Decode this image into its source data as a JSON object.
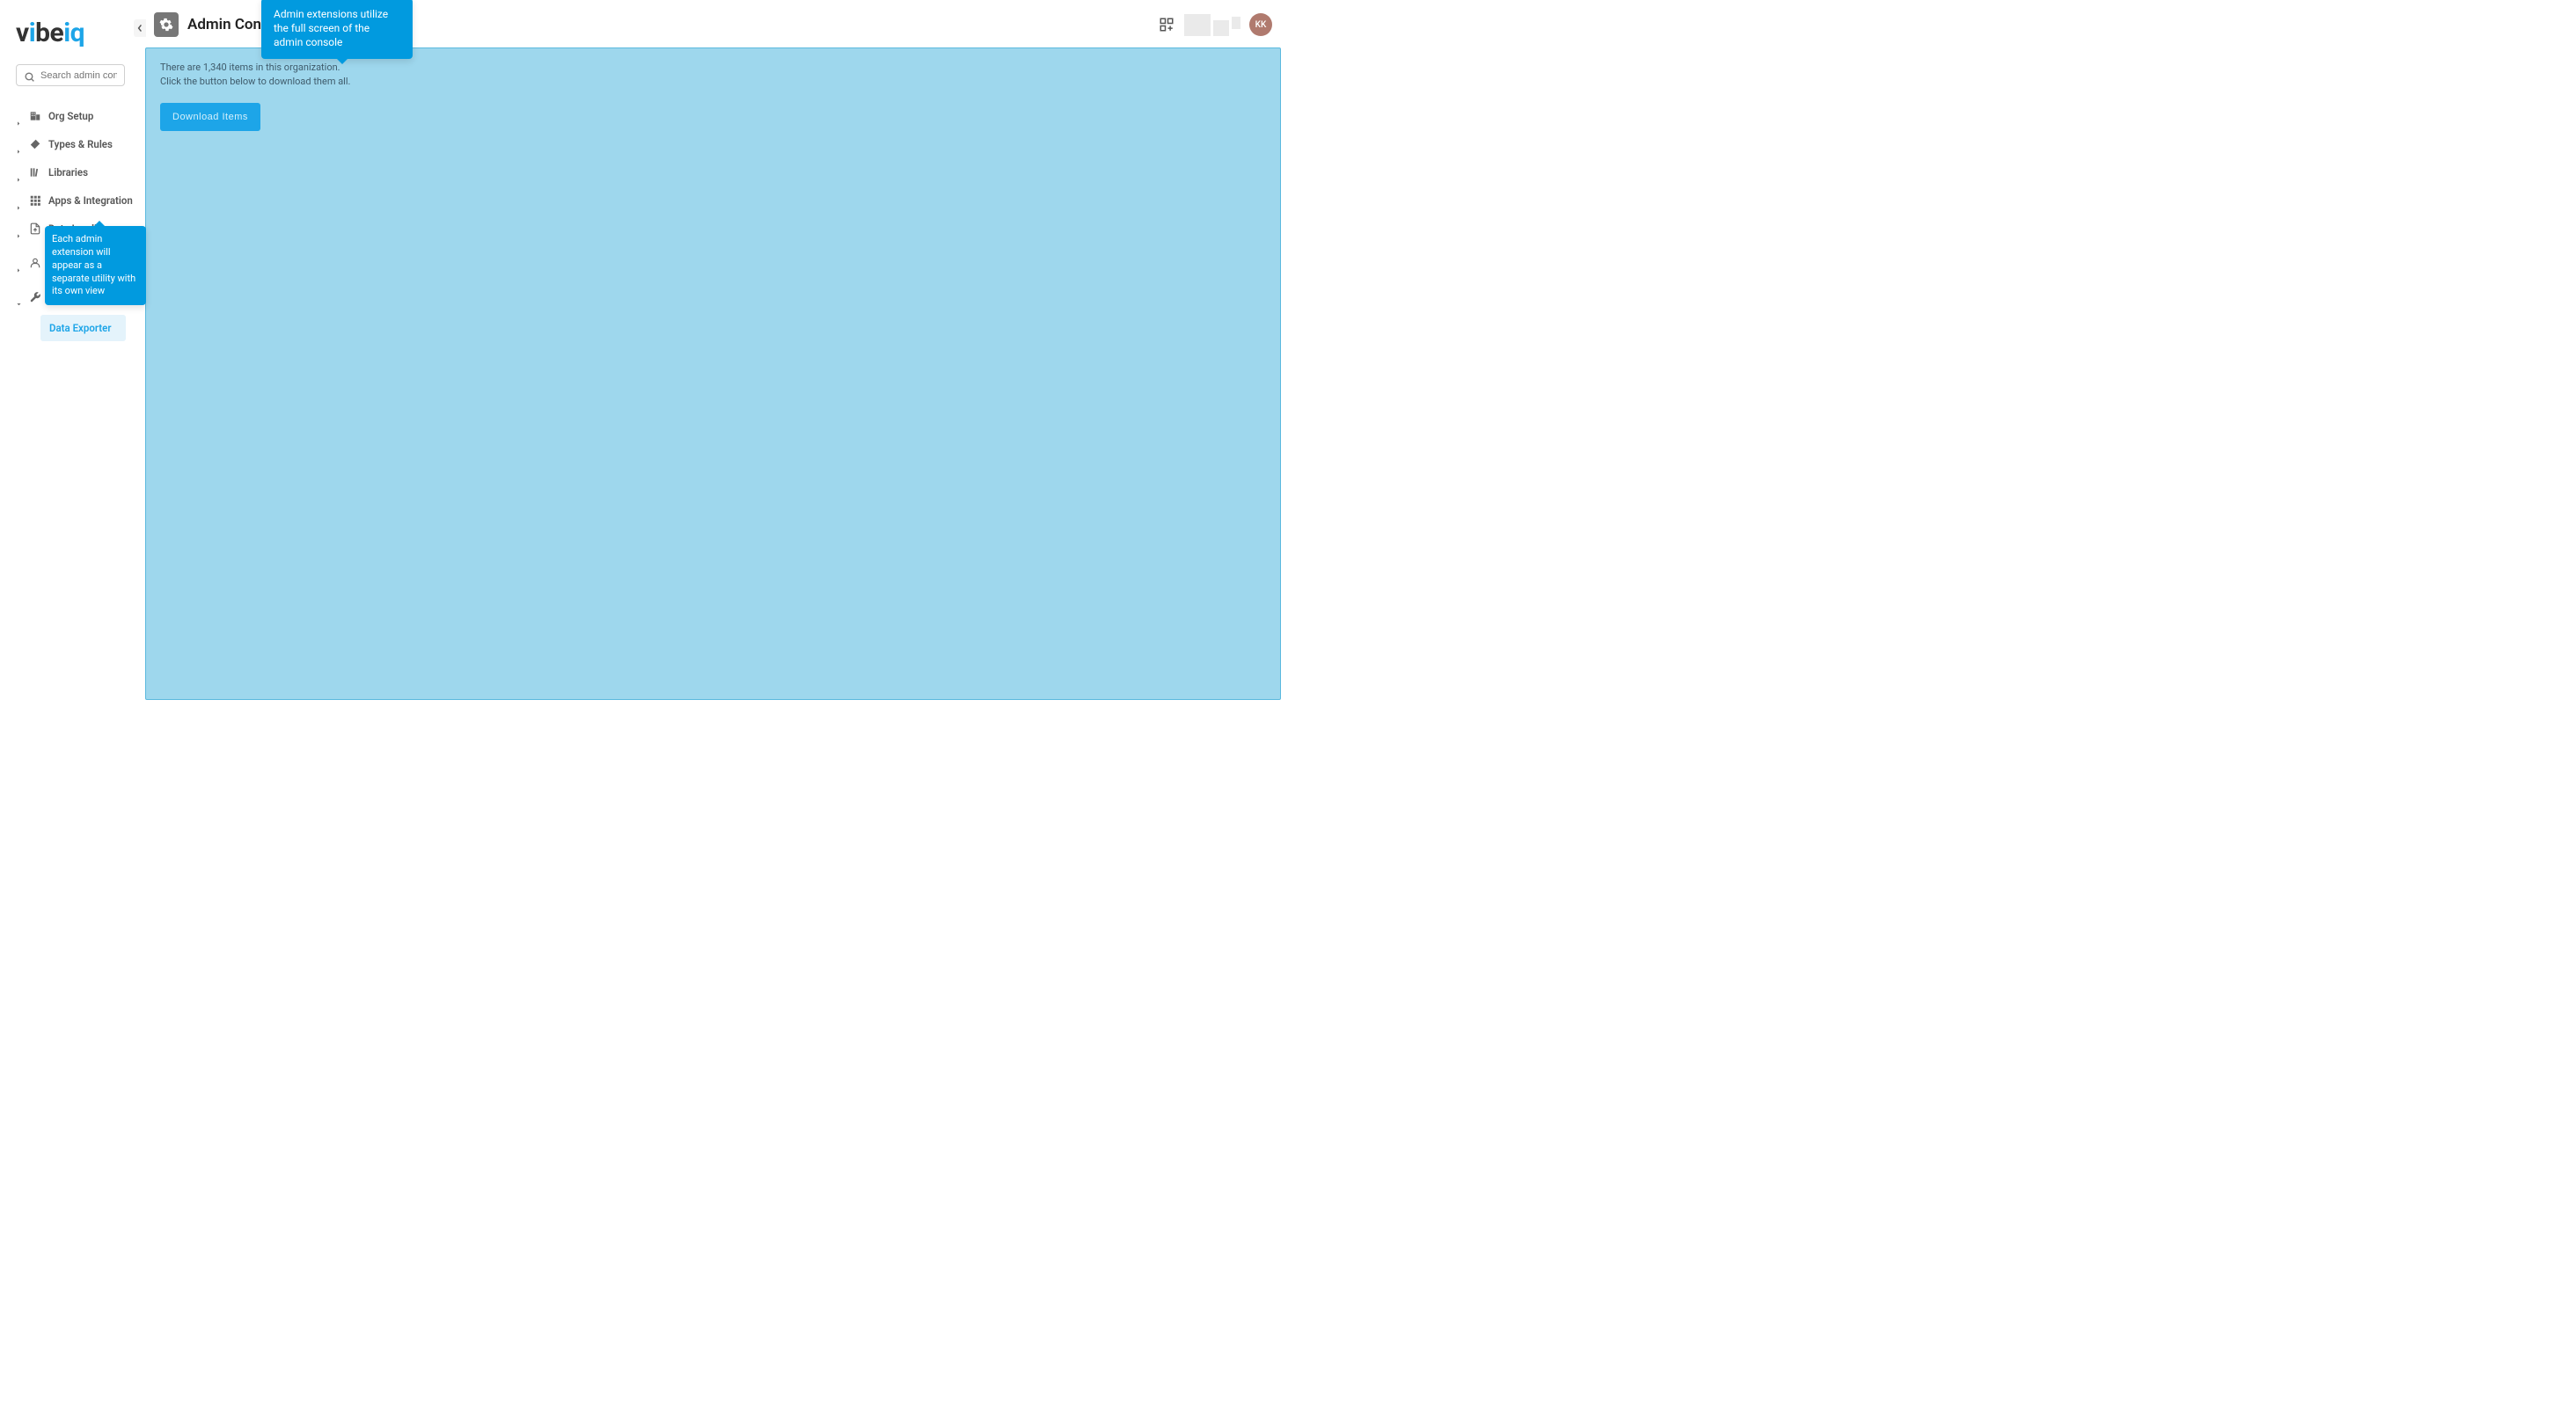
{
  "logo": {
    "part1": "v",
    "part2": "i",
    "part3": "be",
    "part4": "iq"
  },
  "search": {
    "placeholder": "Search admin console"
  },
  "nav": {
    "items": [
      {
        "label": "Org Setup",
        "expanded": false
      },
      {
        "label": "Types & Rules",
        "expanded": false
      },
      {
        "label": "Libraries",
        "expanded": false
      },
      {
        "label": "Apps & Integration",
        "expanded": false
      },
      {
        "label": "Data Loading",
        "expanded": false
      },
      {
        "label": "User Administration",
        "expanded": false
      },
      {
        "label": "Utilities",
        "expanded": true
      }
    ],
    "sub_item": "Data Exporter"
  },
  "header": {
    "title": "Admin Console",
    "avatar": "KK"
  },
  "panel": {
    "line1": "There are 1,340 items in this organization.",
    "line2": "Click the button below to download them all.",
    "button": "Download Items"
  },
  "callouts": {
    "top": "Admin extensions utilize the full screen of the admin console",
    "left": "Each admin extension will appear as a separate utility with its own view"
  }
}
